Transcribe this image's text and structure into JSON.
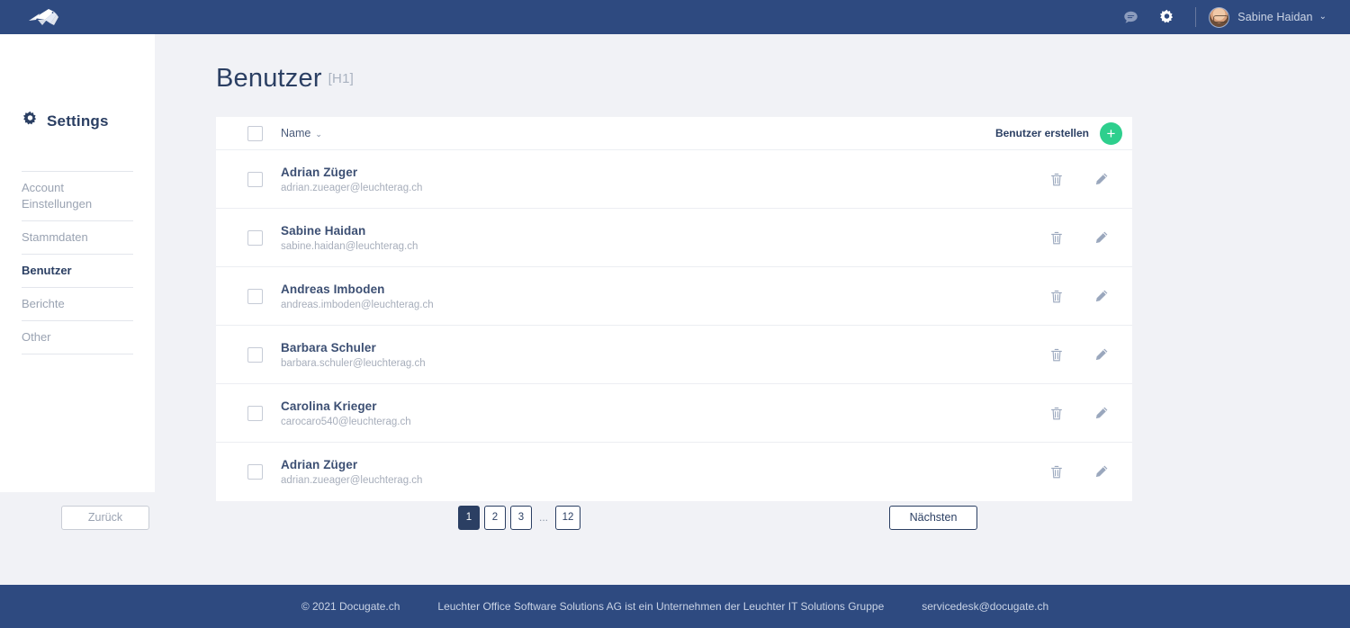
{
  "colors": {
    "navbar": "#2e4a80",
    "accent_green": "#2ecf8d",
    "page_bg": "#f1f2f6",
    "text_dark": "#2b3f63",
    "text_muted": "#9aa3b2"
  },
  "navbar": {
    "logo_name": "docugate-bird-logo",
    "icons": [
      {
        "name": "chat-icon",
        "label": "Nachrichten"
      },
      {
        "name": "gear-icon",
        "label": "Einstellungen"
      }
    ],
    "user": {
      "name": "Sabine Haidan",
      "avatar_name": "user-avatar",
      "caret": "⌄"
    }
  },
  "sidebar": {
    "heading": "Settings",
    "heading_icon": "gear-icon",
    "items": [
      {
        "label": "Account Einstellungen",
        "active": false
      },
      {
        "label": "Stammdaten",
        "active": false
      },
      {
        "label": "Benutzer",
        "active": true
      },
      {
        "label": "Berichte",
        "active": false
      },
      {
        "label": "Other",
        "active": false
      }
    ]
  },
  "main": {
    "title": "Benutzer",
    "title_tag": "[H1]",
    "table": {
      "header": {
        "select_all_checkbox": "",
        "column_name": "Name",
        "sort_chevron": "⌄",
        "create_label": "Benutzer erstellen",
        "create_plus": "+"
      },
      "rows": [
        {
          "name": "Adrian Züger",
          "email": "adrian.zueager@leuchterag.ch"
        },
        {
          "name": "Sabine Haidan",
          "email": "sabine.haidan@leuchterag.ch"
        },
        {
          "name": "Andreas Imboden",
          "email": "andreas.imboden@leuchterag.ch"
        },
        {
          "name": "Barbara Schuler",
          "email": "barbara.schuler@leuchterag.ch"
        },
        {
          "name": "Carolina Krieger",
          "email": "carocaro540@leuchterag.ch"
        },
        {
          "name": "Adrian Züger",
          "email": "adrian.zueager@leuchterag.ch"
        }
      ],
      "row_actions": [
        {
          "name": "delete-icon",
          "label": "Löschen"
        },
        {
          "name": "edit-icon",
          "label": "Bearbeiten"
        }
      ]
    },
    "pagination": {
      "prev_label": "Zurück",
      "next_label": "Nächsten",
      "pages": [
        "1",
        "2",
        "3"
      ],
      "ellipsis": "...",
      "last_page": "12",
      "current_page": "1"
    }
  },
  "footer": {
    "copyright": "© 2021 Docugate.ch",
    "company": "Leuchter Office Software Solutions AG ist ein Unternehmen der Leuchter IT Solutions Gruppe",
    "email": "servicedesk@docugate.ch"
  }
}
